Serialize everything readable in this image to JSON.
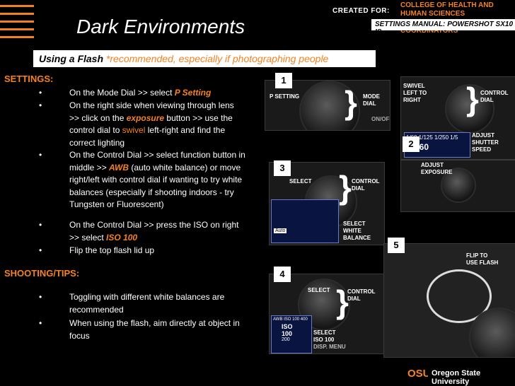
{
  "header": {
    "title": "Dark Environments",
    "created_for": "CREATED FOR:",
    "college_line1": "COLLEGE OF HEALTH AND HUMAN SCIENCES",
    "college_line2": "HHS MARKETING & HHS WEB COORDINATORS",
    "manual": "SETTINGS MANUAL: POWERSHOT SX10 IS"
  },
  "banner": {
    "main": "Using a Flash",
    "note": "*recommended, especially if photographing people"
  },
  "settings": {
    "heading": "SETTINGS:",
    "item1_pre": "On the Mode Dial >> select ",
    "item1_em": "P Setting",
    "item2_pre": "On the right side when viewing through lens >> click on the ",
    "item2_em": "exposure",
    "item2_mid": " button >> use the control dial to ",
    "item2_swivel": "swivel",
    "item2_post": " left-right and find the correct lighting",
    "item3_pre": "On the Control Dial >> select function button in middle >> ",
    "item3_em": "AWB",
    "item3_post": " (auto white balance) or move right/left with control dial if wanting to try white balances (especially if shooting indoors - try Tungsten or Fluorescent)",
    "item4_pre": "On the Control Dial >> press the ISO on right >> select ",
    "item4_em": "ISO 100",
    "item5": "Flip the top flash lid up"
  },
  "tips": {
    "heading": "SHOOTING/TIPS:",
    "item1": "Toggling with different white balances are recommended",
    "item2": "When using the flash, aim directly at object in focus"
  },
  "photos": {
    "p1": {
      "num": "1",
      "label_left": "P SETTING",
      "label_right1": "MODE",
      "label_right2": "DIAL",
      "onoff": "ON/OFF"
    },
    "p2": {
      "num": "2",
      "swivel": "SWIVEL LEFT TO RIGHT",
      "control1": "CONTROL",
      "control2": "DIAL",
      "adjust": "ADJUST SHUTTER SPEED",
      "adjust_exp": "ADJUST EXPOSURE",
      "lcd_values": "1/60 1/125 1/250 1/5",
      "lcd_big": "1/160"
    },
    "p3": {
      "num": "3",
      "select": "SELECT",
      "control1": "CONTROL",
      "control2": "DIAL",
      "wb": "SELECT WHITE BALANCE",
      "auto": "Auto"
    },
    "p4": {
      "num": "4",
      "select": "SELECT",
      "control1": "CONTROL",
      "control2": "DIAL",
      "iso": "SELECT ISO 100",
      "lcd_top": "AWB ISO 100 400",
      "lcd_val1": "ISO",
      "lcd_val2": "100",
      "lcd_val3": "200",
      "menu": "DISP. MENU"
    },
    "p5": {
      "num": "5",
      "flip1": "FLIP TO",
      "flip2": "USE FLASH"
    }
  },
  "footer": {
    "logo": "OSU",
    "university": "Oregon State University"
  },
  "colors": {
    "accent": "#f58220",
    "background": "#000000"
  }
}
